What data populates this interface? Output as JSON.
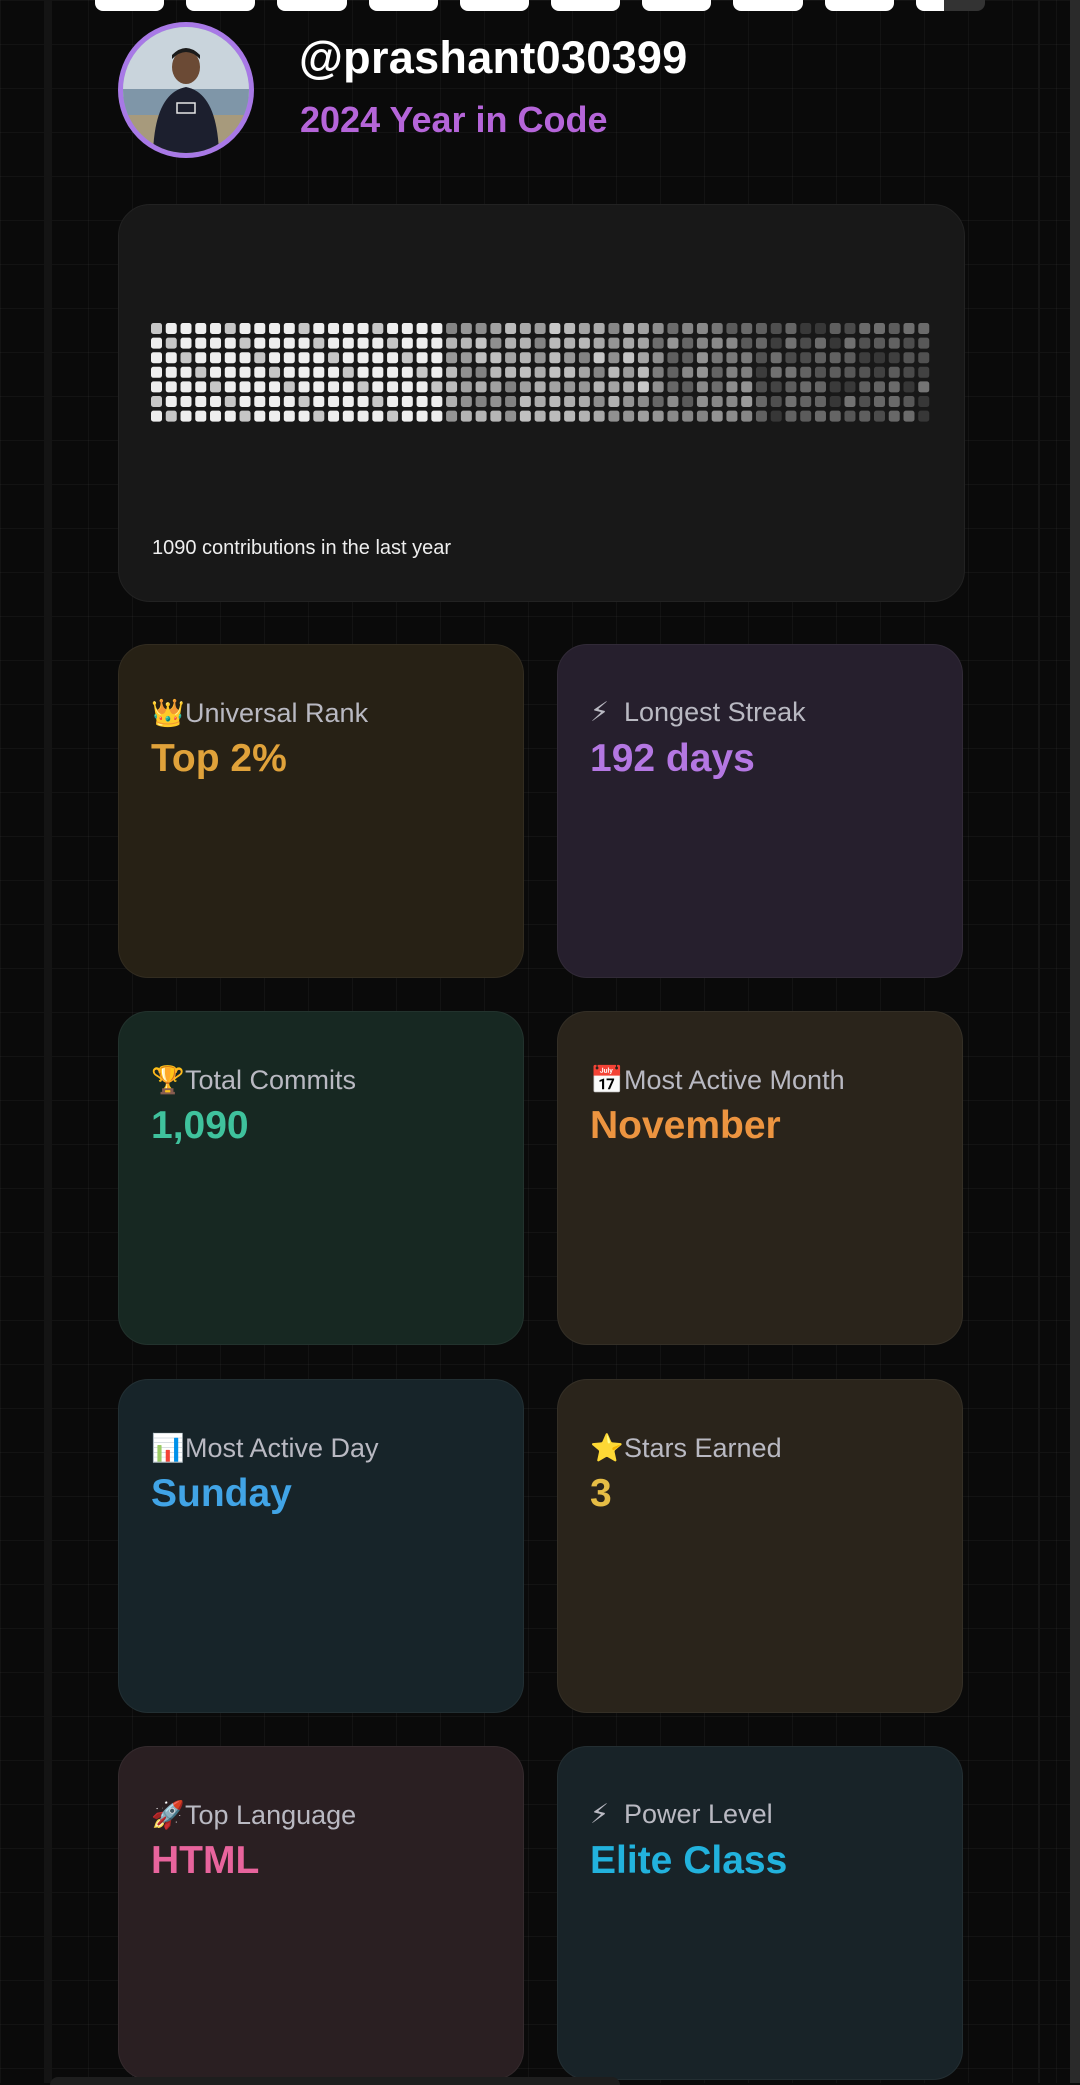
{
  "progress": {
    "segments": [
      1,
      1,
      1,
      1,
      1,
      1,
      1,
      1,
      1,
      0.4
    ]
  },
  "profile": {
    "username": "@prashant030399",
    "subtitle": "2024 Year in Code"
  },
  "contributions": {
    "summary": "1090 contributions in the last year",
    "weeks": 53,
    "days_per_week": 7
  },
  "stats": [
    {
      "icon": "crown-icon",
      "emoji": "👑",
      "label": "Universal Rank",
      "value": "Top 2%",
      "color": "#e0a23a"
    },
    {
      "icon": "lightning-icon",
      "emoji": "⚡",
      "label": "Longest Streak",
      "value": "192 days",
      "color": "#b477e2"
    },
    {
      "icon": "trophy-icon",
      "emoji": "🏆",
      "label": "Total Commits",
      "value": "1,090",
      "color": "#3fc29d"
    },
    {
      "icon": "calendar-icon",
      "emoji": "📅",
      "label": "Most Active Month",
      "value": "November",
      "color": "#ec9440"
    },
    {
      "icon": "bar-chart-icon",
      "emoji": "📊",
      "label": "Most Active Day",
      "value": "Sunday",
      "color": "#41a4e6"
    },
    {
      "icon": "star-icon",
      "emoji": "⭐",
      "label": "Stars Earned",
      "value": "3",
      "color": "#e6bd45"
    },
    {
      "icon": "rocket-icon",
      "emoji": "🚀",
      "label": "Top Language",
      "value": "HTML",
      "color": "#e8649d"
    },
    {
      "icon": "lightning-icon",
      "emoji": "⚡",
      "label": "Power Level",
      "value": "Elite Class",
      "color": "#22b2dd"
    }
  ]
}
